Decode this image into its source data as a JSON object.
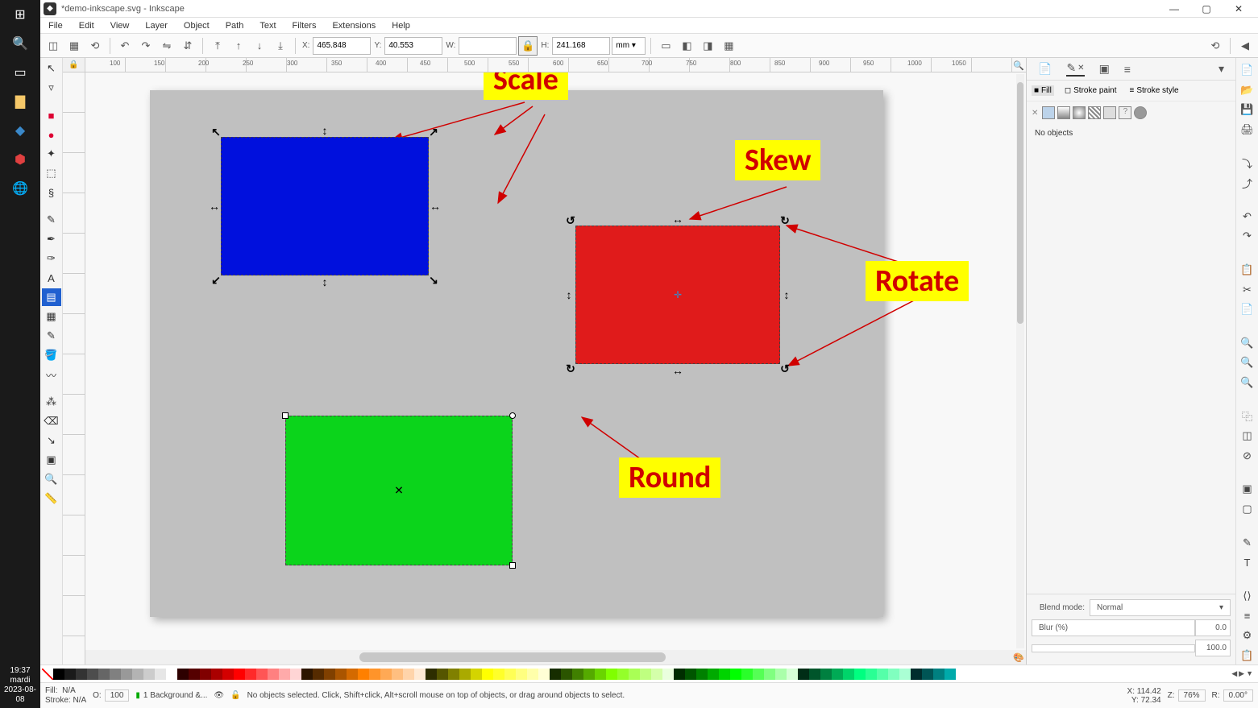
{
  "win_taskbar": {
    "clock_time": "19:37",
    "clock_day": "mardi",
    "clock_date": "2023-08-08"
  },
  "titlebar": {
    "title": "*demo-inkscape.svg - Inkscape"
  },
  "menubar": [
    "File",
    "Edit",
    "View",
    "Layer",
    "Object",
    "Path",
    "Text",
    "Filters",
    "Extensions",
    "Help"
  ],
  "toolbar": {
    "x_label": "X:",
    "x_value": "465.848",
    "y_label": "Y:",
    "y_value": "40.553",
    "w_label": "W:",
    "w_value": "",
    "h_label": "H:",
    "h_value": "241.168",
    "units": "mm"
  },
  "right_panel": {
    "fill_label": "Fill",
    "stroke_paint_label": "Stroke paint",
    "stroke_style_label": "Stroke style",
    "no_objects": "No objects",
    "blend_mode_label": "Blend mode:",
    "blend_mode_value": "Normal",
    "blur_label": "Blur (%)",
    "blur_value": "0.0",
    "opacity_value": "100.0"
  },
  "annotations": {
    "scale": "Scale",
    "skew": "Skew",
    "rotate": "Rotate",
    "round": "Round"
  },
  "status": {
    "fill_label": "Fill:",
    "fill_value": "N/A",
    "stroke_label": "Stroke:",
    "stroke_value": "N/A",
    "o_label": "O:",
    "o_value": "100",
    "layer": "1 Background &...",
    "message": "No objects selected. Click, Shift+click, Alt+scroll mouse on top of objects, or drag around objects to select.",
    "x_label": "X:",
    "x_value": "114.42",
    "y_label": "Y:",
    "y_value": "72.34",
    "z_label": "Z:",
    "z_value": "76%",
    "r_label": "R:",
    "r_value": "0.00°"
  },
  "ruler_ticks": [
    100,
    150,
    200,
    250,
    300,
    350,
    400,
    450,
    500,
    550,
    600,
    650,
    700,
    750,
    800,
    850,
    900,
    950,
    1000,
    1050
  ],
  "palette": [
    "#000000",
    "#1a1a1a",
    "#333333",
    "#4d4d4d",
    "#666666",
    "#808080",
    "#999999",
    "#b3b3b3",
    "#cccccc",
    "#e6e6e6",
    "#ffffff",
    "#2d0000",
    "#550000",
    "#800000",
    "#aa0000",
    "#d40000",
    "#ff0000",
    "#ff2a2a",
    "#ff5555",
    "#ff8080",
    "#ffaaaa",
    "#ffd5d5",
    "#2d1600",
    "#552b00",
    "#804000",
    "#aa5500",
    "#d46a00",
    "#ff8000",
    "#ff942a",
    "#ffa955",
    "#ffbf80",
    "#ffd4aa",
    "#ffead5",
    "#2d2d00",
    "#555500",
    "#808000",
    "#aaaa00",
    "#d4d400",
    "#ffff00",
    "#ffff2a",
    "#ffff55",
    "#ffff80",
    "#ffffaa",
    "#ffffd5",
    "#162d00",
    "#2b5500",
    "#408000",
    "#55aa00",
    "#6ad400",
    "#80ff00",
    "#94ff2a",
    "#a9ff55",
    "#bfff80",
    "#d4ffaa",
    "#eaffde",
    "#002d00",
    "#005500",
    "#008000",
    "#00aa00",
    "#00d400",
    "#00ff00",
    "#2aff2a",
    "#55ff55",
    "#80ff80",
    "#aaffaa",
    "#d5ffd5",
    "#002d16",
    "#00552b",
    "#008040",
    "#00aa55",
    "#00d46a",
    "#00ff80",
    "#2aff94",
    "#55ffa9",
    "#80ffbf",
    "#aaffd4",
    "#002d2d",
    "#005555",
    "#008080",
    "#00aaaa"
  ]
}
